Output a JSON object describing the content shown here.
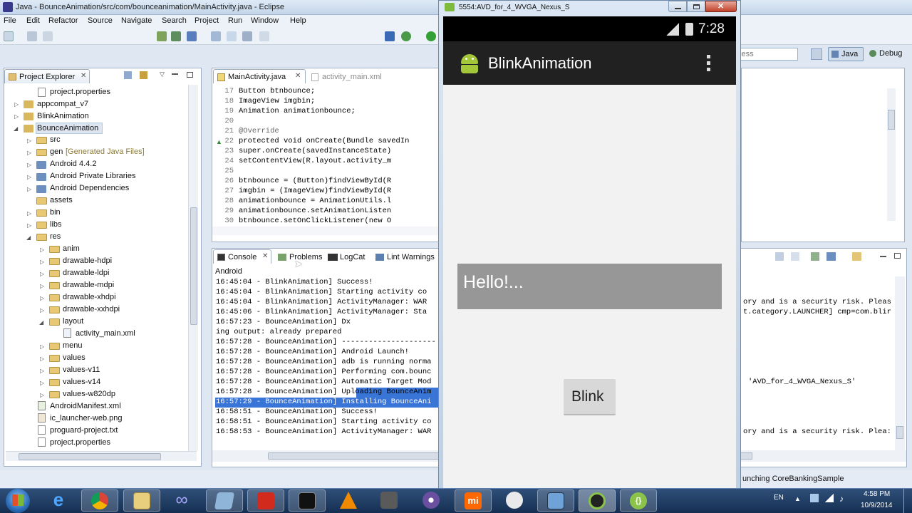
{
  "eclipse": {
    "title": "Java - BounceAnimation/src/com/bounceanimation/MainActivity.java - Eclipse",
    "menu": [
      "File",
      "Edit",
      "Refactor",
      "Source",
      "Navigate",
      "Search",
      "Project",
      "Run",
      "Window",
      "Help"
    ],
    "search_partial": "cess",
    "perspectives": {
      "java": "Java",
      "debug": "Debug"
    },
    "project_explorer": {
      "title": "Project Explorer",
      "items": [
        {
          "label": "project.properties",
          "type": "file"
        },
        {
          "label": "appcompat_v7",
          "type": "project"
        },
        {
          "label": "BlinkAnimation",
          "type": "project"
        },
        {
          "label": "BounceAnimation",
          "type": "project"
        },
        {
          "label": "src",
          "type": "folder"
        },
        {
          "label": "gen",
          "type": "folder",
          "note": "[Generated Java Files]"
        },
        {
          "label": "Android 4.4.2",
          "type": "lib"
        },
        {
          "label": "Android Private Libraries",
          "type": "lib"
        },
        {
          "label": "Android Dependencies",
          "type": "lib"
        },
        {
          "label": "assets",
          "type": "folder"
        },
        {
          "label": "bin",
          "type": "folder"
        },
        {
          "label": "libs",
          "type": "folder"
        },
        {
          "label": "res",
          "type": "folder"
        },
        {
          "label": "anim",
          "type": "folder"
        },
        {
          "label": "drawable-hdpi",
          "type": "folder"
        },
        {
          "label": "drawable-ldpi",
          "type": "folder"
        },
        {
          "label": "drawable-mdpi",
          "type": "folder"
        },
        {
          "label": "drawable-xhdpi",
          "type": "folder"
        },
        {
          "label": "drawable-xxhdpi",
          "type": "folder"
        },
        {
          "label": "layout",
          "type": "folder"
        },
        {
          "label": "activity_main.xml",
          "type": "file"
        },
        {
          "label": "menu",
          "type": "folder"
        },
        {
          "label": "values",
          "type": "folder"
        },
        {
          "label": "values-v11",
          "type": "folder"
        },
        {
          "label": "values-v14",
          "type": "folder"
        },
        {
          "label": "values-w820dp",
          "type": "folder"
        },
        {
          "label": "AndroidManifest.xml",
          "type": "file"
        },
        {
          "label": "ic_launcher-web.png",
          "type": "file"
        },
        {
          "label": "proguard-project.txt",
          "type": "file"
        },
        {
          "label": "project.properties",
          "type": "file"
        }
      ]
    },
    "editor": {
      "tabs": [
        "MainActivity.java",
        "activity_main.xml"
      ],
      "lines": [
        {
          "n": "17",
          "t": "    Button btnbounce;"
        },
        {
          "n": "18",
          "t": "    ImageView imgbin;"
        },
        {
          "n": "19",
          "t": "    Animation animationbounce;"
        },
        {
          "n": "20",
          "t": ""
        },
        {
          "n": "21",
          "t": "    @Override"
        },
        {
          "n": "22",
          "t": "    protected void onCreate(Bundle savedIn"
        },
        {
          "n": "23",
          "t": "        super.onCreate(savedInstanceState)"
        },
        {
          "n": "24",
          "t": "        setContentView(R.layout.activity_m"
        },
        {
          "n": "25",
          "t": ""
        },
        {
          "n": "26",
          "t": "        btnbounce = (Button)findViewById(R"
        },
        {
          "n": "27",
          "t": "        imgbin = (ImageView)findViewById(R"
        },
        {
          "n": "28",
          "t": "        animationbounce = AnimationUtils.l"
        },
        {
          "n": "29",
          "t": "        animationbounce.setAnimationListen"
        },
        {
          "n": "30",
          "t": "        btnbounce.setOnClickListener(new O"
        }
      ]
    },
    "console": {
      "tabs": [
        "Console",
        "Problems",
        "LogCat",
        "Lint Warnings"
      ],
      "header": "Android",
      "lines": [
        "16:45:04 - BlinkAnimation] Success!",
        "16:45:04 - BlinkAnimation] Starting activity co",
        "16:45:04 - BlinkAnimation] ActivityManager: WAR",
        "16:45:06 - BlinkAnimation] ActivityManager: Sta",
        "16:57:23 - BounceAnimation] Dx",
        "ing output: already prepared",
        "16:57:28 - BounceAnimation] ---------------------",
        "16:57:28 - BounceAnimation] Android Launch!",
        "16:57:28 - BounceAnimation] adb is running norma",
        "16:57:28 - BounceAnimation] Performing com.bounc",
        "16:57:28 - BounceAnimation] Automatic Target Mod",
        "16:57:28 - BounceAnimation] Uploading BounceAnim",
        "16:57:29 - BounceAnimation] Installing BounceAni",
        "16:58:51 - BounceAnimation] Success!",
        "16:58:51 - BounceAnimation] Starting activity co",
        "16:58:53 - BounceAnimation] ActivityManager: WAR"
      ],
      "right": [
        {
          "row": 2,
          "t": "ory and is a security risk. Pleas"
        },
        {
          "row": 3,
          "t": "t.category.LAUNCHER] cmp=com.blir"
        },
        {
          "row": 10,
          "t": "'AVD_for_4_WVGA_Nexus_S'"
        },
        {
          "row": 15,
          "t": "ory and is a security risk. Plea:"
        }
      ]
    },
    "status": "unching CoreBankingSample"
  },
  "emulator": {
    "title": "5554:AVD_for_4_WVGA_Nexus_S",
    "clock": "7:28",
    "app_title": "BlinkAnimation",
    "hello_text": "Hello!...",
    "button_label": "Blink"
  },
  "taskbar": {
    "lang": "EN",
    "time": "4:58 PM",
    "date": "10/9/2014"
  }
}
